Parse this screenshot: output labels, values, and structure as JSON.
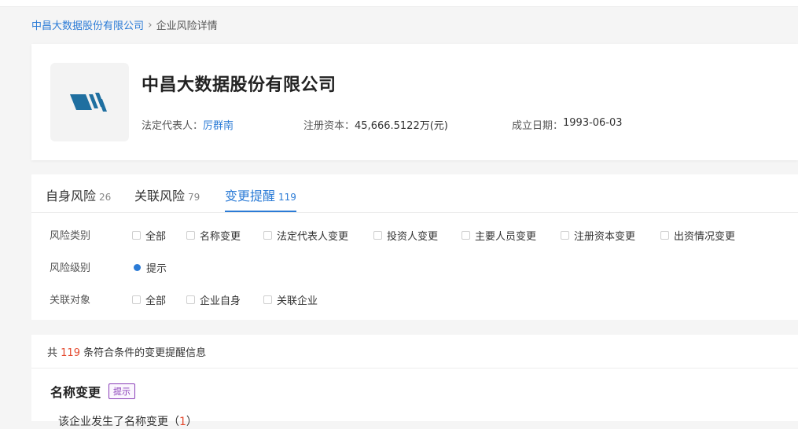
{
  "breadcrumb": {
    "home": "中昌大数据股份有限公司",
    "separator": "›",
    "current": "企业风险详情"
  },
  "company": {
    "name": "中昌大数据股份有限公司",
    "legal_rep_label": "法定代表人：",
    "legal_rep_value": "厉群南",
    "reg_capital_label": "注册资本：",
    "reg_capital_value": "45,666.5122万(元)",
    "founded_label": "成立日期：",
    "founded_value": "1993-06-03"
  },
  "tabs": [
    {
      "label": "自身风险",
      "count": "26"
    },
    {
      "label": "关联风险",
      "count": "79"
    },
    {
      "label": "变更提醒",
      "count": "119"
    }
  ],
  "filters": {
    "category_label": "风险类别",
    "category_options": [
      "全部",
      "名称变更",
      "法定代表人变更",
      "投资人变更",
      "主要人员变更",
      "注册资本变更",
      "出资情况变更"
    ],
    "level_label": "风险级别",
    "level_option": "提示",
    "target_label": "关联对象",
    "target_options": [
      "全部",
      "企业自身",
      "关联企业"
    ]
  },
  "summary": {
    "prefix": "共",
    "count": "119",
    "suffix": "条符合条件的变更提醒信息"
  },
  "item": {
    "title": "名称变更",
    "tag": "提示",
    "desc_prefix": "该企业发生了名称变更（",
    "desc_count": "1",
    "desc_suffix": "）"
  },
  "colors": {
    "accent": "#2b7bd6",
    "highlight": "#e44a2f",
    "tag": "#8a3fb8",
    "logo_blue": "#1f6fa0"
  }
}
